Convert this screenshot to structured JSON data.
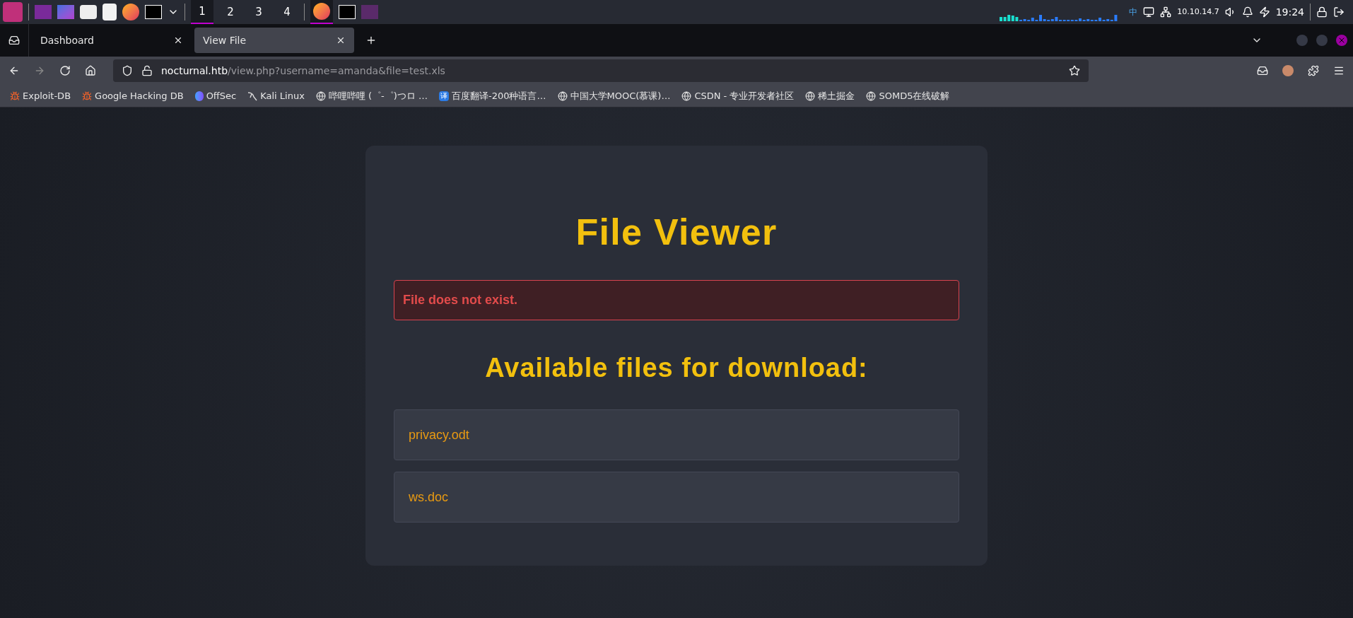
{
  "taskbar": {
    "workspaces": [
      {
        "label": "1",
        "selected": true
      },
      {
        "label": "2",
        "selected": false
      },
      {
        "label": "3",
        "selected": false
      },
      {
        "label": "4",
        "selected": false
      }
    ],
    "tray": {
      "ime": "中",
      "ip": "10.10.14.7",
      "clock": "19:24"
    }
  },
  "browser": {
    "tabs": [
      {
        "label": "Dashboard",
        "selected": false
      },
      {
        "label": "View File",
        "selected": true
      }
    ],
    "url": {
      "host": "nocturnal.htb",
      "path": "/view.php?username=amanda&file=test.xls"
    },
    "bookmarks": [
      {
        "label": "Exploit-DB",
        "kind": "bug"
      },
      {
        "label": "Google Hacking DB",
        "kind": "bug"
      },
      {
        "label": "OffSec",
        "kind": "offsec"
      },
      {
        "label": "Kali Linux",
        "kind": "kali"
      },
      {
        "label": "哔哩哔哩 (゜-゜)つロ …",
        "kind": "globe"
      },
      {
        "label": "百度翻译-200种语言…",
        "kind": "badge",
        "badge": "译"
      },
      {
        "label": "中国大学MOOC(慕课)…",
        "kind": "globe"
      },
      {
        "label": "CSDN - 专业开发者社区",
        "kind": "globe"
      },
      {
        "label": "稀土掘金",
        "kind": "globe"
      },
      {
        "label": "SOMD5在线破解",
        "kind": "globe"
      }
    ]
  },
  "page": {
    "title": "File Viewer",
    "error": "File does not exist.",
    "files_heading": "Available files for download:",
    "files": [
      "privacy.odt",
      "ws.doc"
    ]
  }
}
